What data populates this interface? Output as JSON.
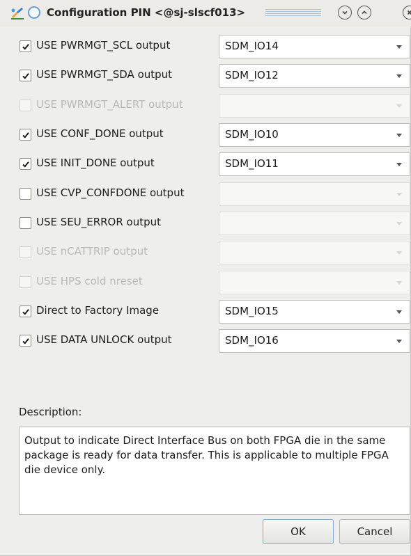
{
  "window": {
    "title": "Configuration PIN <@sj-slscf013>"
  },
  "rows": [
    {
      "label": "USE PWRMGT_SCL output",
      "checked": true,
      "enabled": true,
      "value": "SDM_IO14"
    },
    {
      "label": "USE PWRMGT_SDA output",
      "checked": true,
      "enabled": true,
      "value": "SDM_IO12"
    },
    {
      "label": "USE PWRMGT_ALERT output",
      "checked": false,
      "enabled": false,
      "value": ""
    },
    {
      "label": "USE CONF_DONE output",
      "checked": true,
      "enabled": true,
      "value": "SDM_IO10"
    },
    {
      "label": "USE INIT_DONE output",
      "checked": true,
      "enabled": true,
      "value": "SDM_IO11"
    },
    {
      "label": "USE CVP_CONFDONE output",
      "checked": false,
      "enabled": true,
      "value": ""
    },
    {
      "label": "USE SEU_ERROR output",
      "checked": false,
      "enabled": true,
      "value": ""
    },
    {
      "label": "USE nCATTRIP output",
      "checked": false,
      "enabled": false,
      "value": ""
    },
    {
      "label": "USE HPS cold nreset",
      "checked": false,
      "enabled": false,
      "value": ""
    },
    {
      "label": "Direct to Factory Image",
      "checked": true,
      "enabled": true,
      "value": "SDM_IO15"
    },
    {
      "label": "USE DATA UNLOCK output",
      "checked": true,
      "enabled": true,
      "value": "SDM_IO16"
    }
  ],
  "description": {
    "label": "Description:",
    "text": "Output to indicate Direct Interface Bus on both FPGA die in the same package is ready for data transfer. This is applicable to multiple FPGA die device only."
  },
  "buttons": {
    "ok": "OK",
    "cancel": "Cancel"
  },
  "icons": {
    "app": "quartus-app-icon",
    "title_radio": "radio-icon",
    "shade": "chevron-down-icon",
    "raise": "chevron-up-icon",
    "close": "close-icon"
  },
  "colors": {
    "accent": "#6a9ccf",
    "background": "#eeeeec",
    "disabled_text": "#b8b8b6"
  }
}
